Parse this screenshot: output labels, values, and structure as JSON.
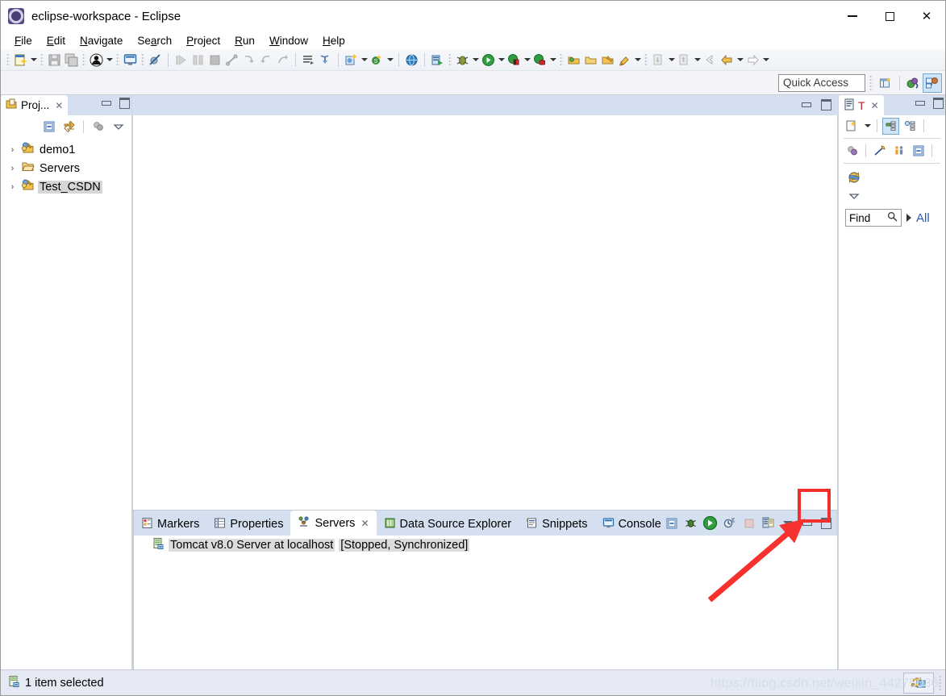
{
  "window": {
    "title": "eclipse-workspace - Eclipse",
    "app_icon": "eclipse-icon",
    "controls": {
      "minimize": "–",
      "maximize": "□",
      "close": "✕"
    }
  },
  "menubar": {
    "items": [
      {
        "label": "File",
        "accel": "F"
      },
      {
        "label": "Edit",
        "accel": "E"
      },
      {
        "label": "Navigate",
        "accel": "N"
      },
      {
        "label": "Search",
        "accel": "a"
      },
      {
        "label": "Project",
        "accel": "P"
      },
      {
        "label": "Run",
        "accel": "R"
      },
      {
        "label": "Window",
        "accel": "W"
      },
      {
        "label": "Help",
        "accel": "H"
      }
    ]
  },
  "toolbar": {
    "icons": [
      "new-wizard-icon",
      "save-icon",
      "save-all-icon",
      "user-icon",
      "console-view-icon",
      "no-marker-icon",
      "run-step-icon",
      "pause-icon",
      "terminate-icon",
      "step-into-icon",
      "step-over-icon",
      "step-return-icon",
      "drop-to-frame-icon",
      "publish-icon",
      "new-java-project-icon",
      "new-class-icon",
      "open-web-browser-icon",
      "run-on-server-icon",
      "debug-icon",
      "run-icon",
      "coverage-icon",
      "profile-icon",
      "open-type-icon",
      "open-task-icon",
      "search-icon",
      "next-annotation-icon",
      "previous-annotation-icon",
      "back-icon",
      "forward-icon"
    ]
  },
  "quick_access": {
    "placeholder": "Quick Access",
    "value": "",
    "perspective_buttons": [
      {
        "name": "open-perspective-icon",
        "active": false
      },
      {
        "name": "java-ee-perspective-icon",
        "active": false
      },
      {
        "name": "java-perspective-icon",
        "active": true
      }
    ]
  },
  "project_explorer": {
    "tab_label": "Proj...",
    "tab_icon": "project-explorer-icon",
    "close_label": "✕",
    "toolbar_icons": [
      "collapse-all-icon",
      "link-with-editor-icon",
      "focus-on-active-task-icon",
      "view-menu-icon"
    ],
    "tree": [
      {
        "label": "demo1",
        "icon": "java-web-project-icon",
        "expanded": false,
        "selected": false
      },
      {
        "label": "Servers",
        "icon": "folder-icon",
        "expanded": false,
        "selected": false
      },
      {
        "label": "Test_CSDN",
        "icon": "java-web-project-icon",
        "expanded": false,
        "selected": true
      }
    ]
  },
  "editor_area": {
    "minimize_icon": "minimize-icon",
    "maximize_icon": "maximize-icon",
    "content": ""
  },
  "outline_panel": {
    "tab_label": "T",
    "tab_icon": "task-list-icon",
    "close_label": "✕",
    "toolbar_icons": [
      "new-task-icon",
      "new-task-dropdown-icon",
      "categorized-view-icon",
      "scheduled-view-icon",
      "focus-on-workweek-icon",
      "clear-filter-icon",
      "show-task-hierarchy-icon",
      "collapse-all-icon",
      "synchronize-changed-icon",
      "view-menu-icon"
    ],
    "find": {
      "label": "Find",
      "icon": "search-icon",
      "value": ""
    },
    "all_label": "All"
  },
  "bottom_panel": {
    "tabs": [
      {
        "label": "Markers",
        "icon": "markers-icon",
        "active": false,
        "closeable": false
      },
      {
        "label": "Properties",
        "icon": "properties-icon",
        "active": false,
        "closeable": false
      },
      {
        "label": "Servers",
        "icon": "servers-icon",
        "active": true,
        "closeable": true
      },
      {
        "label": "Data Source Explorer",
        "icon": "data-source-icon",
        "active": false,
        "closeable": false
      },
      {
        "label": "Snippets",
        "icon": "snippets-icon",
        "active": false,
        "closeable": false
      },
      {
        "label": "Console",
        "icon": "console-icon",
        "active": false,
        "closeable": false
      }
    ],
    "close_label": "✕",
    "toolbar_icons": [
      "collapse-all-icon",
      "debug-server-icon",
      "start-server-icon",
      "profile-server-icon",
      "stop-server-icon",
      "publish-server-icon",
      "view-menu-icon",
      "minimize-icon",
      "maximize-icon"
    ],
    "servers": [
      {
        "icon": "tomcat-server-icon",
        "name": "Tomcat v8.0 Server at localhost",
        "state": "[Stopped, Synchronized]"
      }
    ]
  },
  "statusbar": {
    "icon": "selected-item-icon",
    "text": "1 item selected",
    "indicator_icon": "workspace-sync-icon"
  },
  "watermark": {
    "text": "https://blog.csdn.net/weixin_44275036"
  },
  "annotations": {
    "highlight_box": {
      "target": "start-server-button",
      "color": "#f22f2f"
    },
    "arrow": {
      "from_label": "pointer-origin",
      "to_label": "start-server-button",
      "color": "#f7312e"
    }
  },
  "colors": {
    "accent": "#2a5db0",
    "tab_bar": "#d4e0f0",
    "annotation_red": "#f22f2f",
    "selection_gray": "#d6d6d6"
  }
}
